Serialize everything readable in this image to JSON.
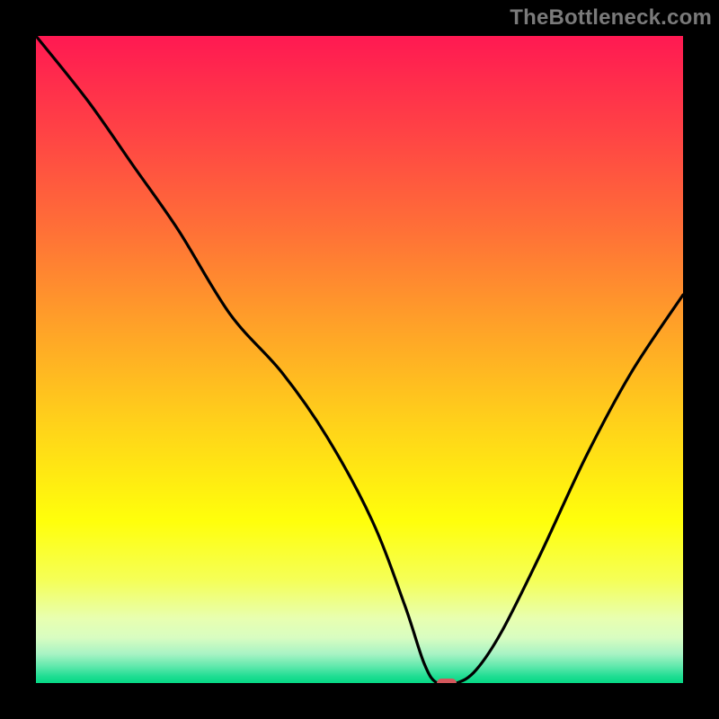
{
  "watermark": "TheBottleneck.com",
  "chart_data": {
    "type": "line",
    "title": "",
    "xlabel": "",
    "ylabel": "",
    "xlim": [
      0,
      100
    ],
    "ylim": [
      0,
      100
    ],
    "grid": false,
    "legend": false,
    "series": [
      {
        "name": "bottleneck-curve",
        "x": [
          0,
          8,
          15,
          22,
          30,
          38,
          45,
          52,
          57,
          60,
          62,
          65,
          68,
          72,
          78,
          85,
          92,
          100
        ],
        "y": [
          100,
          90,
          80,
          70,
          57,
          48,
          38,
          25,
          12,
          3,
          0,
          0,
          2,
          8,
          20,
          35,
          48,
          60
        ]
      }
    ],
    "marker": {
      "x": 63.5,
      "y": 0,
      "width_pct": 3.0,
      "height_pct": 1.4,
      "color": "#D4575C"
    },
    "gradient_stops": [
      {
        "offset": 0.0,
        "color": "#FF1952"
      },
      {
        "offset": 0.15,
        "color": "#FF4345"
      },
      {
        "offset": 0.3,
        "color": "#FF7037"
      },
      {
        "offset": 0.45,
        "color": "#FFA228"
      },
      {
        "offset": 0.6,
        "color": "#FFD21A"
      },
      {
        "offset": 0.75,
        "color": "#FFFF0B"
      },
      {
        "offset": 0.84,
        "color": "#F5FF56"
      },
      {
        "offset": 0.9,
        "color": "#E8FFB0"
      },
      {
        "offset": 0.93,
        "color": "#D8FDC1"
      },
      {
        "offset": 0.955,
        "color": "#A8F3C4"
      },
      {
        "offset": 0.975,
        "color": "#5DE8AB"
      },
      {
        "offset": 0.99,
        "color": "#1EDD92"
      },
      {
        "offset": 1.0,
        "color": "#05D884"
      }
    ]
  }
}
